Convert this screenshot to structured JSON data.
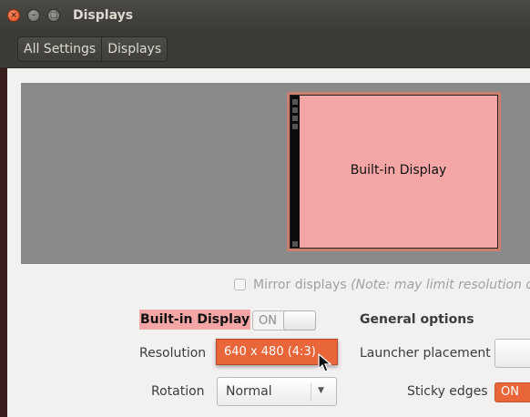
{
  "window": {
    "title": "Displays",
    "close_glyph": "×",
    "minimize_glyph": "–",
    "maximize_glyph": "□"
  },
  "breadcrumb": {
    "items": [
      "All Settings",
      "Displays"
    ]
  },
  "arrangement": {
    "monitor_label": "Built-in Display"
  },
  "mirror": {
    "label": "Mirror displays",
    "note": "(Note: may limit resolution opt"
  },
  "display": {
    "name": "Built-in Display",
    "power_switch": "ON",
    "resolution_label": "Resolution",
    "resolution_value": "640 x 480 (4:3)",
    "rotation_label": "Rotation",
    "rotation_value": "Normal"
  },
  "general": {
    "heading": "General options",
    "launcher_label": "Launcher placement",
    "sticky_label": "Sticky edges",
    "sticky_value": "ON"
  },
  "colors": {
    "accent": "#e9663a",
    "monitor_fill": "#f4a6a6",
    "arrangement_bg": "#8a8a8a"
  }
}
